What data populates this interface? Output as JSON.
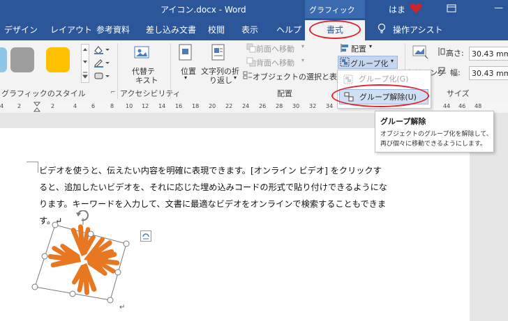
{
  "titlebar": {
    "doc_title": "アイコン.docx  -  Word",
    "context_tab": "グラフィック ツール",
    "user": "はま"
  },
  "tabs": [
    "デザイン",
    "レイアウト",
    "参考資料",
    "差し込み文書",
    "校閲",
    "表示",
    "ヘルプ"
  ],
  "active_tab": "書式",
  "tell_me": "操作アシスト",
  "ribbon": {
    "styles_group": "グラフィックのスタイル",
    "alt_text": {
      "line1": "代替テ",
      "line2": "キスト"
    },
    "accessibility_group": "アクセシビリティ",
    "position": "位置",
    "wrap_text": {
      "line1": "文字列の折",
      "line2": "り返し"
    },
    "bring_forward": "前面へ移動",
    "send_backward": "背面へ移動",
    "selection_pane": "オブジェクトの選択と表示",
    "align": "配置",
    "group": "グループ化",
    "arrange_group": "配置",
    "crop": "トリミング",
    "height_label": "高さ:",
    "height_value": "30.43 mm",
    "width_label": "幅:",
    "width_value": "30.43 mm",
    "size_group": "サイズ"
  },
  "dropdown": {
    "group": "グループ化(G)",
    "ungroup": "グループ解除(U)"
  },
  "tooltip": {
    "title": "グループ解除",
    "line1": "オブジェクトのグループ化を解除して、",
    "line2": "再び個々に移動できるようにします。"
  },
  "ruler": [
    "4",
    "2",
    "2",
    "4",
    "6",
    "8",
    "10",
    "12",
    "14",
    "16",
    "18",
    "20",
    "22",
    "24",
    "26",
    "28",
    "30",
    "32",
    "34",
    "36",
    "38",
    "40",
    "42",
    "44",
    "46",
    "48"
  ],
  "document": {
    "lines": [
      "ビデオを使うと、伝えたい内容を明確に表現できます。[オンライン ビデオ] をクリックす",
      "ると、追加したいビデオを、それに応じた埋め込みコードの形式で貼り付けできるようにな",
      "ります。キーワードを入力して、文書に最適なビデオをオンラインで検索することもできま",
      "す。↵"
    ],
    "para_mark": "↵"
  },
  "colors": {
    "brand": "#2b579a",
    "highlight": "#e0242c",
    "icon_orange": "#e87722"
  }
}
